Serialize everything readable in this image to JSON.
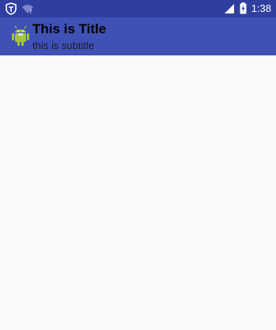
{
  "status_bar": {
    "time": "1:38",
    "icons": [
      "shield-icon",
      "wifi-question-icon",
      "signal-icon",
      "battery-charging-icon"
    ]
  },
  "toolbar": {
    "title": "This is Title",
    "subtitle": "this is subtitle",
    "logo_icon": "android-icon"
  },
  "colors": {
    "status_bar": "#303f9f",
    "app_bar": "#3f51b5",
    "background": "#fafafa"
  }
}
